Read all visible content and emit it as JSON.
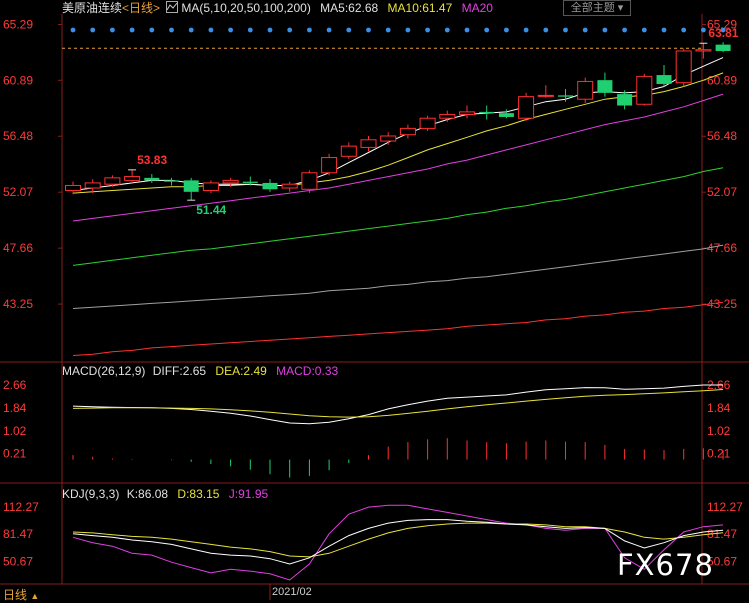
{
  "header": {
    "instrument": "美原油连续",
    "period": "<日线>",
    "ma_label": "MA(5,10,20,50,100,200)",
    "ma5": "MA5:62.68",
    "ma10": "MA10:61.47",
    "ma20": "MA20",
    "theme_button": "全部主题"
  },
  "macd_header": {
    "label": "MACD(26,12,9)",
    "diff": "DIFF:2.65",
    "dea": "DEA:2.49",
    "macd": "MACD:0.33"
  },
  "kdj_header": {
    "label": "KDJ(9,3,3)",
    "k": "K:86.08",
    "d": "D:83.15",
    "j": "J:91.95"
  },
  "footer": {
    "tab": "日线",
    "date": "2021/02",
    "watermark": "FX678"
  },
  "colors": {
    "up": "#ff3030",
    "down": "#20d070",
    "ma5": "#ffffff",
    "ma10": "#e8e23a",
    "ma20": "#e040e0",
    "ma50": "#30d030",
    "ma100": "#a0a0a0",
    "ma200": "#ff3030",
    "axis": "#ff3a3a"
  },
  "chart_data": [
    {
      "type": "candlestick",
      "y_ticks": [
        "65.29",
        "60.89",
        "56.48",
        "52.07",
        "47.66",
        "43.25"
      ],
      "ylim": [
        39.0,
        65.8
      ],
      "candles": [
        {
          "o": 52.2,
          "h": 52.9,
          "l": 51.9,
          "c": 52.6
        },
        {
          "o": 52.4,
          "h": 53.1,
          "l": 52.0,
          "c": 52.8
        },
        {
          "o": 52.7,
          "h": 53.4,
          "l": 52.5,
          "c": 53.2
        },
        {
          "o": 53.0,
          "h": 53.83,
          "l": 52.8,
          "c": 53.3
        },
        {
          "o": 53.2,
          "h": 53.5,
          "l": 52.8,
          "c": 53.0
        },
        {
          "o": 53.0,
          "h": 53.2,
          "l": 52.6,
          "c": 52.9
        },
        {
          "o": 53.0,
          "h": 53.2,
          "l": 51.44,
          "c": 52.1
        },
        {
          "o": 52.2,
          "h": 53.0,
          "l": 52.0,
          "c": 52.8
        },
        {
          "o": 52.8,
          "h": 53.2,
          "l": 52.5,
          "c": 53.0
        },
        {
          "o": 52.9,
          "h": 53.3,
          "l": 52.6,
          "c": 52.8
        },
        {
          "o": 52.8,
          "h": 53.1,
          "l": 52.1,
          "c": 52.3
        },
        {
          "o": 52.4,
          "h": 52.9,
          "l": 52.1,
          "c": 52.7
        },
        {
          "o": 52.3,
          "h": 53.8,
          "l": 52.0,
          "c": 53.6
        },
        {
          "o": 53.6,
          "h": 55.1,
          "l": 53.4,
          "c": 54.8
        },
        {
          "o": 54.9,
          "h": 56.0,
          "l": 54.7,
          "c": 55.7
        },
        {
          "o": 55.6,
          "h": 56.5,
          "l": 55.3,
          "c": 56.2
        },
        {
          "o": 56.1,
          "h": 56.8,
          "l": 55.8,
          "c": 56.5
        },
        {
          "o": 56.6,
          "h": 57.4,
          "l": 56.3,
          "c": 57.1
        },
        {
          "o": 57.1,
          "h": 58.1,
          "l": 56.9,
          "c": 57.9
        },
        {
          "o": 57.9,
          "h": 58.5,
          "l": 57.6,
          "c": 58.2
        },
        {
          "o": 58.2,
          "h": 58.9,
          "l": 57.9,
          "c": 58.4
        },
        {
          "o": 58.4,
          "h": 58.9,
          "l": 57.8,
          "c": 58.3
        },
        {
          "o": 58.3,
          "h": 58.6,
          "l": 57.9,
          "c": 58.0
        },
        {
          "o": 57.9,
          "h": 59.9,
          "l": 57.7,
          "c": 59.6
        },
        {
          "o": 59.7,
          "h": 60.5,
          "l": 59.5,
          "c": 59.7
        },
        {
          "o": 59.7,
          "h": 60.2,
          "l": 59.2,
          "c": 59.6
        },
        {
          "o": 59.4,
          "h": 61.1,
          "l": 59.1,
          "c": 60.8
        },
        {
          "o": 60.9,
          "h": 61.5,
          "l": 59.6,
          "c": 59.9
        },
        {
          "o": 59.8,
          "h": 60.1,
          "l": 58.6,
          "c": 58.9
        },
        {
          "o": 59.0,
          "h": 61.4,
          "l": 58.9,
          "c": 61.2
        },
        {
          "o": 61.3,
          "h": 62.1,
          "l": 60.4,
          "c": 60.6
        },
        {
          "o": 60.7,
          "h": 63.4,
          "l": 60.4,
          "c": 63.2
        },
        {
          "o": 63.2,
          "h": 63.81,
          "l": 62.6,
          "c": 63.3
        },
        {
          "o": 63.7,
          "h": 63.9,
          "l": 63.1,
          "c": 63.2
        }
      ],
      "annotations": [
        {
          "text": "53.83",
          "index": 3,
          "value": 53.83,
          "color": "#ff3030"
        },
        {
          "text": "51.44",
          "index": 6,
          "value": 51.44,
          "color": "#20d070"
        },
        {
          "text": "63.81",
          "index": 32,
          "value": 63.81,
          "color": "#ff3030"
        }
      ],
      "ma_lines": {
        "ma5": [
          52.2,
          52.4,
          52.6,
          52.8,
          53.0,
          53.0,
          52.8,
          52.7,
          52.7,
          52.7,
          52.6,
          52.6,
          53.0,
          53.6,
          54.4,
          55.2,
          56.0,
          56.7,
          57.3,
          57.8,
          58.2,
          58.3,
          58.4,
          58.8,
          59.2,
          59.4,
          59.9,
          60.0,
          59.9,
          60.0,
          60.4,
          61.3,
          62.0,
          62.68
        ],
        "ma10": [
          52.0,
          52.1,
          52.2,
          52.3,
          52.4,
          52.5,
          52.5,
          52.6,
          52.6,
          52.7,
          52.6,
          52.6,
          52.8,
          53.0,
          53.3,
          53.7,
          54.2,
          54.8,
          55.4,
          55.9,
          56.4,
          56.9,
          57.3,
          57.8,
          58.2,
          58.6,
          59.0,
          59.4,
          59.6,
          59.7,
          60.0,
          60.4,
          60.9,
          61.47
        ],
        "ma20": [
          49.8,
          50.0,
          50.2,
          50.4,
          50.6,
          50.8,
          51.0,
          51.2,
          51.4,
          51.6,
          51.8,
          52.0,
          52.2,
          52.4,
          52.7,
          53.0,
          53.3,
          53.6,
          53.9,
          54.3,
          54.6,
          55.0,
          55.4,
          55.8,
          56.2,
          56.6,
          57.0,
          57.4,
          57.7,
          58.0,
          58.4,
          58.8,
          59.3,
          59.8
        ],
        "ma50": [
          46.3,
          46.5,
          46.7,
          46.9,
          47.1,
          47.3,
          47.5,
          47.6,
          47.8,
          48.0,
          48.2,
          48.4,
          48.6,
          48.8,
          49.0,
          49.2,
          49.4,
          49.6,
          49.8,
          50.0,
          50.3,
          50.5,
          50.8,
          51.0,
          51.3,
          51.5,
          51.8,
          52.1,
          52.4,
          52.7,
          53.0,
          53.3,
          53.7,
          54.0
        ],
        "ma100": [
          42.9,
          43.0,
          43.1,
          43.2,
          43.3,
          43.4,
          43.5,
          43.6,
          43.7,
          43.8,
          43.9,
          44.0,
          44.1,
          44.3,
          44.4,
          44.5,
          44.7,
          44.8,
          45.0,
          45.1,
          45.3,
          45.4,
          45.6,
          45.8,
          46.0,
          46.2,
          46.4,
          46.6,
          46.8,
          47.0,
          47.2,
          47.4,
          47.6,
          47.9
        ],
        "ma200": [
          39.2,
          39.3,
          39.5,
          39.6,
          39.8,
          39.9,
          40.0,
          40.1,
          40.2,
          40.3,
          40.4,
          40.5,
          40.6,
          40.7,
          40.8,
          40.9,
          41.0,
          41.1,
          41.2,
          41.3,
          41.5,
          41.6,
          41.7,
          41.8,
          42.0,
          42.1,
          42.3,
          42.4,
          42.6,
          42.7,
          42.9,
          43.0,
          43.2,
          43.4
        ]
      }
    },
    {
      "type": "macd",
      "y_ticks": [
        "2.66",
        "1.84",
        "1.02",
        "0.21"
      ],
      "ylim": [
        -0.3,
        2.9
      ],
      "diff": [
        1.9,
        1.88,
        1.86,
        1.85,
        1.84,
        1.82,
        1.78,
        1.72,
        1.65,
        1.55,
        1.42,
        1.3,
        1.27,
        1.33,
        1.45,
        1.6,
        1.8,
        1.95,
        2.08,
        2.18,
        2.22,
        2.26,
        2.3,
        2.4,
        2.48,
        2.52,
        2.56,
        2.55,
        2.5,
        2.52,
        2.54,
        2.6,
        2.65,
        2.65
      ],
      "dea": [
        1.82,
        1.83,
        1.84,
        1.84,
        1.84,
        1.83,
        1.82,
        1.8,
        1.77,
        1.73,
        1.68,
        1.62,
        1.56,
        1.52,
        1.51,
        1.52,
        1.57,
        1.64,
        1.72,
        1.8,
        1.88,
        1.95,
        2.01,
        2.08,
        2.14,
        2.2,
        2.25,
        2.29,
        2.31,
        2.34,
        2.37,
        2.41,
        2.45,
        2.49
      ],
      "hist": [
        0.16,
        0.1,
        0.04,
        0.02,
        0.0,
        -0.02,
        -0.08,
        -0.16,
        -0.24,
        -0.36,
        -0.52,
        -0.64,
        -0.58,
        -0.38,
        -0.12,
        0.16,
        0.46,
        0.62,
        0.72,
        0.76,
        0.68,
        0.62,
        0.58,
        0.64,
        0.68,
        0.64,
        0.62,
        0.52,
        0.38,
        0.36,
        0.34,
        0.38,
        0.4,
        0.33
      ]
    },
    {
      "type": "kdj",
      "y_ticks": [
        "112.27",
        "81.47",
        "50.67"
      ],
      "ylim": [
        30,
        120
      ],
      "k": [
        82,
        80,
        78,
        75,
        73,
        70,
        65,
        60,
        58,
        57,
        54,
        48,
        55,
        68,
        80,
        88,
        94,
        97,
        98,
        98,
        96,
        95,
        93,
        92,
        90,
        88,
        89,
        88,
        74,
        66,
        72,
        80,
        84,
        86.08
      ],
      "d": [
        84,
        83,
        81,
        79,
        78,
        76,
        73,
        70,
        67,
        65,
        62,
        57,
        56,
        60,
        68,
        76,
        83,
        88,
        91,
        93,
        94,
        94,
        93,
        93,
        92,
        90,
        90,
        88,
        84,
        78,
        76,
        78,
        81,
        83.15
      ],
      "j": [
        78,
        72,
        68,
        60,
        58,
        50,
        44,
        38,
        42,
        40,
        37,
        30,
        48,
        82,
        104,
        112,
        114,
        114,
        110,
        106,
        102,
        98,
        94,
        92,
        88,
        86,
        88,
        88,
        55,
        42,
        64,
        84,
        90,
        91.95
      ]
    }
  ]
}
